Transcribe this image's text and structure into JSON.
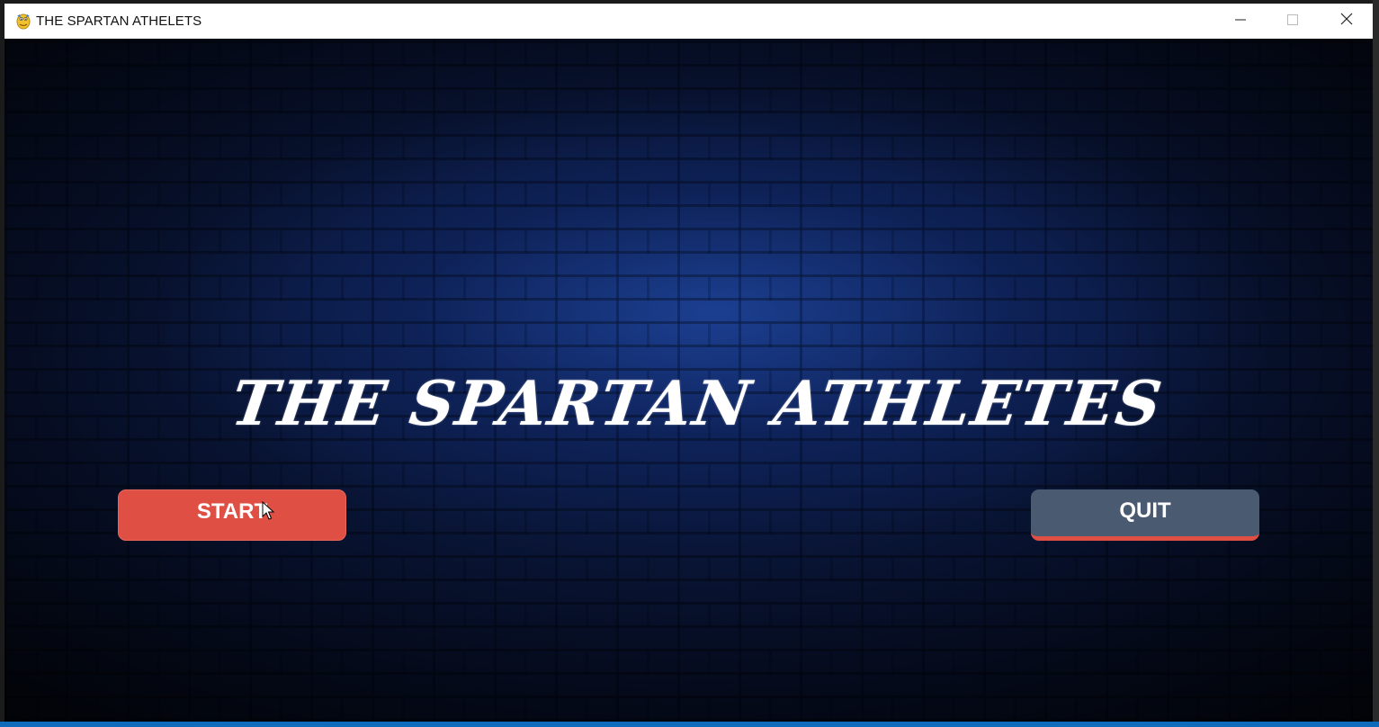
{
  "window": {
    "title": "THE SPARTAN ATHELETS",
    "icon": "pygame-snake-icon",
    "controls": {
      "minimize_icon": "minimize-icon",
      "maximize_icon": "maximize-icon",
      "close_icon": "close-icon"
    }
  },
  "game": {
    "title": "THE SPARTAN ATHLETES",
    "background": "blue-brick-wall",
    "buttons": {
      "start_label": "START",
      "quit_label": "QUIT"
    }
  },
  "colors": {
    "start_button": "#df4f44",
    "quit_button": "#4a5a70",
    "quit_underline": "#df4f44",
    "title_text": "#ffffff",
    "background_glow": "#1f4aa8"
  }
}
